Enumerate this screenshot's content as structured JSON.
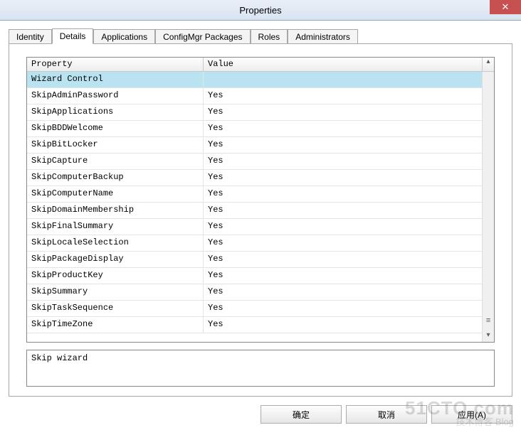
{
  "window": {
    "title": "Properties",
    "close_glyph": "✕"
  },
  "tabs": [
    {
      "label": "Identity",
      "active": false
    },
    {
      "label": "Details",
      "active": true
    },
    {
      "label": "Applications",
      "active": false
    },
    {
      "label": "ConfigMgr Packages",
      "active": false
    },
    {
      "label": "Roles",
      "active": false
    },
    {
      "label": "Administrators",
      "active": false
    }
  ],
  "columns": {
    "property": "Property",
    "value": "Value",
    "scroll_up_glyph": "▴"
  },
  "rows": [
    {
      "property": "Wizard Control",
      "value": "",
      "selected": true
    },
    {
      "property": "SkipAdminPassword",
      "value": "Yes",
      "selected": false
    },
    {
      "property": "SkipApplications",
      "value": "Yes",
      "selected": false
    },
    {
      "property": "SkipBDDWelcome",
      "value": "Yes",
      "selected": false
    },
    {
      "property": "SkipBitLocker",
      "value": "Yes",
      "selected": false
    },
    {
      "property": "SkipCapture",
      "value": "Yes",
      "selected": false
    },
    {
      "property": "SkipComputerBackup",
      "value": "Yes",
      "selected": false
    },
    {
      "property": "SkipComputerName",
      "value": "Yes",
      "selected": false
    },
    {
      "property": "SkipDomainMembership",
      "value": "Yes",
      "selected": false
    },
    {
      "property": "SkipFinalSummary",
      "value": "Yes",
      "selected": false
    },
    {
      "property": "SkipLocaleSelection",
      "value": "Yes",
      "selected": false
    },
    {
      "property": "SkipPackageDisplay",
      "value": "Yes",
      "selected": false
    },
    {
      "property": "SkipProductKey",
      "value": "Yes",
      "selected": false
    },
    {
      "property": "SkipSummary",
      "value": "Yes",
      "selected": false
    },
    {
      "property": "SkipTaskSequence",
      "value": "Yes",
      "selected": false
    },
    {
      "property": "SkipTimeZone",
      "value": "Yes",
      "selected": false
    }
  ],
  "detail_text": "Skip wizard",
  "scrollbar": {
    "grip_glyph": "≡",
    "down_glyph": "▾"
  },
  "buttons": {
    "ok": "确定",
    "cancel": "取消",
    "apply": "应用(A)"
  },
  "watermark": {
    "line1": "51CTO.com",
    "line2": "技术博客 Blog"
  }
}
